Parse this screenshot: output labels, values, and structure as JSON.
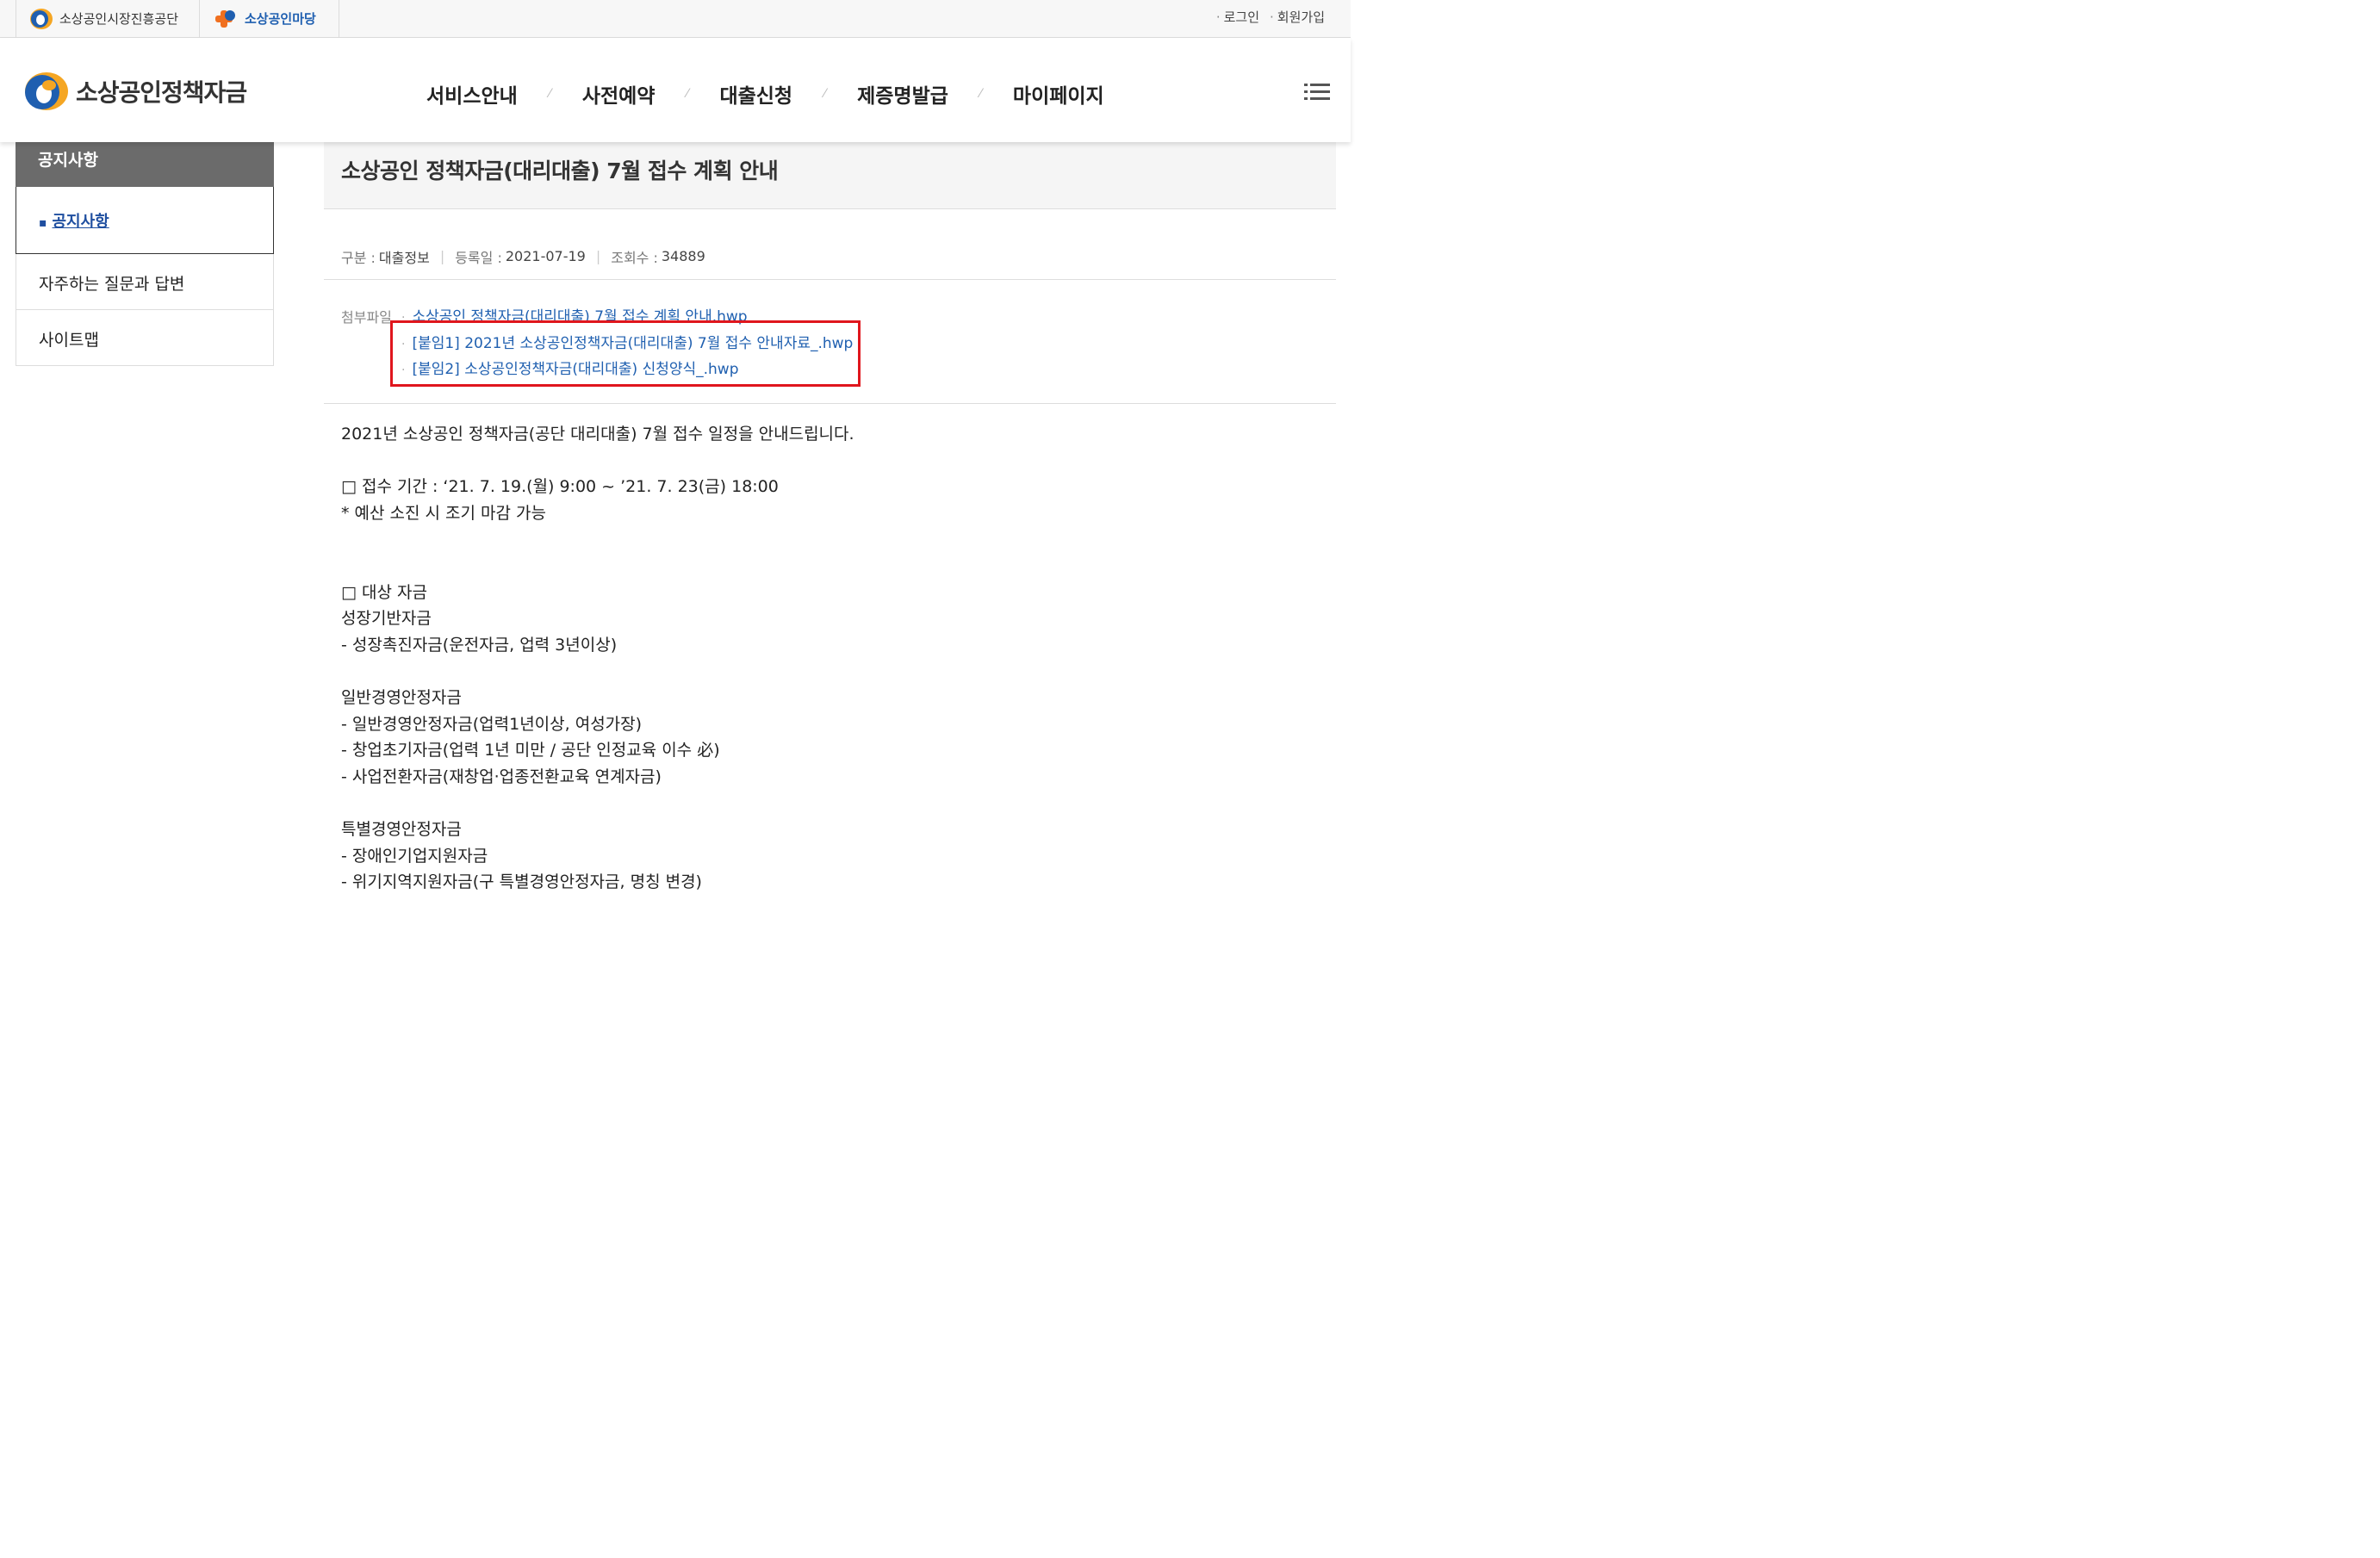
{
  "topbar": {
    "site1_label": "소상공인시장진흥공단",
    "site2_label": "소상공인마당",
    "login": "로그인",
    "signup": "회원가입"
  },
  "header": {
    "logo_text": "소상공인정책자금",
    "nav": [
      "서비스안내",
      "사전예약",
      "대출신청",
      "제증명발급",
      "마이페이지"
    ],
    "menu_icon": "hamburger-menu-icon"
  },
  "sidebar": {
    "heading": "공지사항",
    "items": [
      {
        "label": "공지사항",
        "active": true
      },
      {
        "label": "자주하는 질문과 답변"
      },
      {
        "label": "사이트맵"
      }
    ]
  },
  "post": {
    "title": "소상공인 정책자금(대리대출) 7월 접수 계획 안내",
    "category_key": "구분 :",
    "category_value": "대출정보",
    "date_key": "등록일 :",
    "date_value": "2021-07-19",
    "views_key": "조회수 :",
    "views_value": "34889",
    "attach_label": "첨부파일",
    "files": [
      "소상공인 정책자금(대리대출) 7월 접수 계획 안내.hwp",
      "[붙임1] 2021년 소상공인정책자금(대리대출) 7월 접수 안내자료_.hwp",
      "[붙임2] 소상공인정책자금(대리대출) 신청양식_.hwp"
    ],
    "body": [
      "2021년 소상공인 정책자금(공단 대리대출) 7월 접수 일정을 안내드립니다.",
      "",
      "□ 접수 기간 : ‘21. 7. 19.(월) 9:00 ~ ’21. 7. 23(금) 18:00",
      "* 예산 소진 시 조기 마감 가능",
      "",
      "",
      "□ 대상 자금",
      "성장기반자금",
      "- 성장촉진자금(운전자금, 업력 3년이상)",
      "",
      "일반경영안정자금",
      "- 일반경영안정자금(업력1년이상, 여성가장)",
      "- 창업초기자금(업력 1년 미만 / 공단 인정교육 이수 必)",
      "- 사업전환자금(재창업·업종전환교육 연계자금)",
      "",
      "특별경영안정자금",
      "- 장애인기업지원자금",
      "- 위기지역지원자금(구 특별경영안정자금, 명칭 변경)"
    ]
  },
  "colors": {
    "accent_blue": "#2060b0",
    "highlight_red": "#e0161d",
    "sidebar_head": "#6b6b6b"
  }
}
